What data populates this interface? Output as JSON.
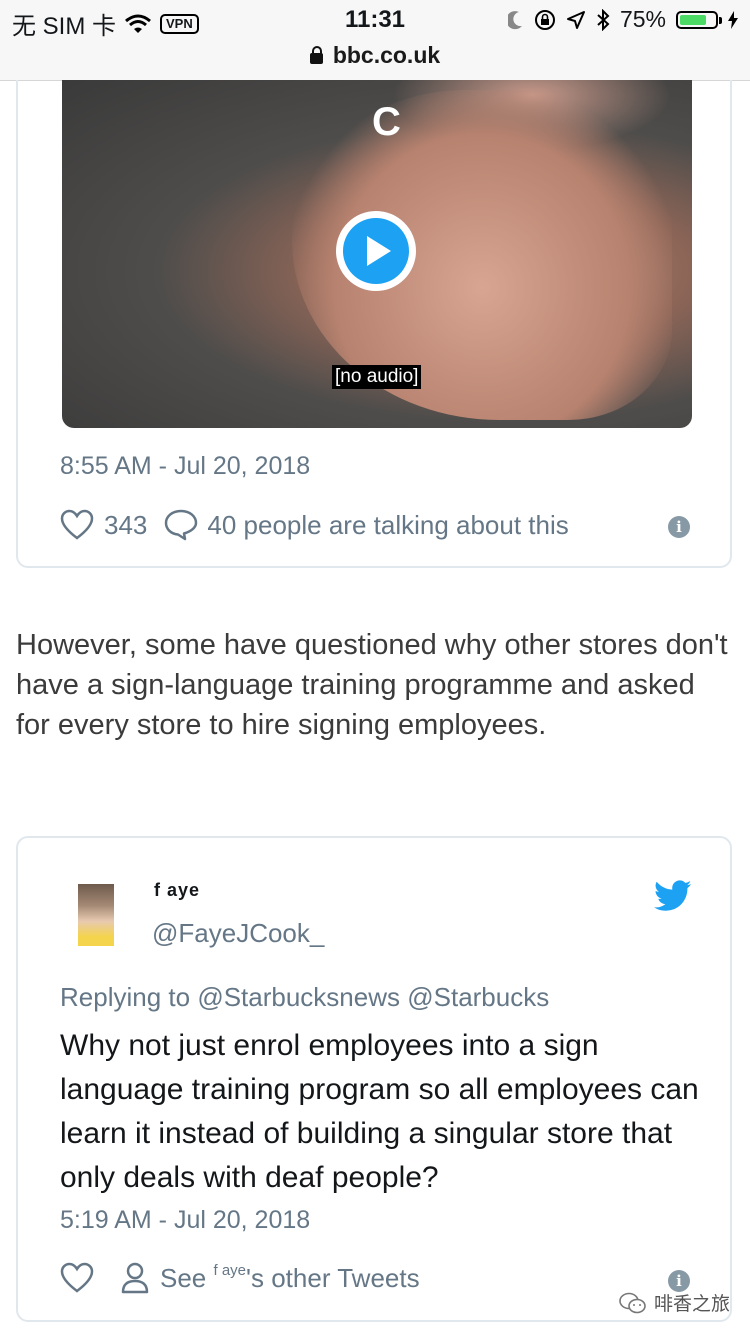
{
  "status_bar": {
    "carrier": "无 SIM 卡",
    "vpn": "VPN",
    "time": "11:31",
    "battery": "75%",
    "battery_level": 0.75
  },
  "url_bar": {
    "domain": "bbc.co.uk"
  },
  "embedded_tweet_1": {
    "video_letter": "C",
    "caption": "[no audio]",
    "timestamp": "8:55 AM - Jul 20, 2018",
    "likes": "343",
    "talking": "40 people are talking about this"
  },
  "article": {
    "paragraph": "However, some have questioned why other stores don't have a sign-language training programme and asked for every store to hire signing employees."
  },
  "embedded_tweet_2": {
    "display_name": "f aye",
    "handle": "@FayeJCook_",
    "replying_prefix": "Replying to",
    "reply_handles": "@Starbucksnews @Starbucks",
    "text": "Why not just enrol employees into a sign language training program so all employees can learn it instead of building a singular store that only deals with deaf people?",
    "timestamp": "5:19 AM - Jul 20, 2018",
    "see_label": "See",
    "see_name": "f aye",
    "see_suffix": "'s other Tweets"
  },
  "watermark": "啡香之旅",
  "colors": {
    "twitter_blue": "#1da1f2",
    "muted": "#657786",
    "border": "#e1e8ed"
  },
  "icons": [
    "wifi-icon",
    "moon-icon",
    "rotation-lock-icon",
    "location-icon",
    "bluetooth-icon",
    "battery-icon",
    "lock-icon",
    "play-icon",
    "heart-icon",
    "comment-icon",
    "info-icon",
    "twitter-bird-icon",
    "person-icon",
    "wechat-icon"
  ]
}
